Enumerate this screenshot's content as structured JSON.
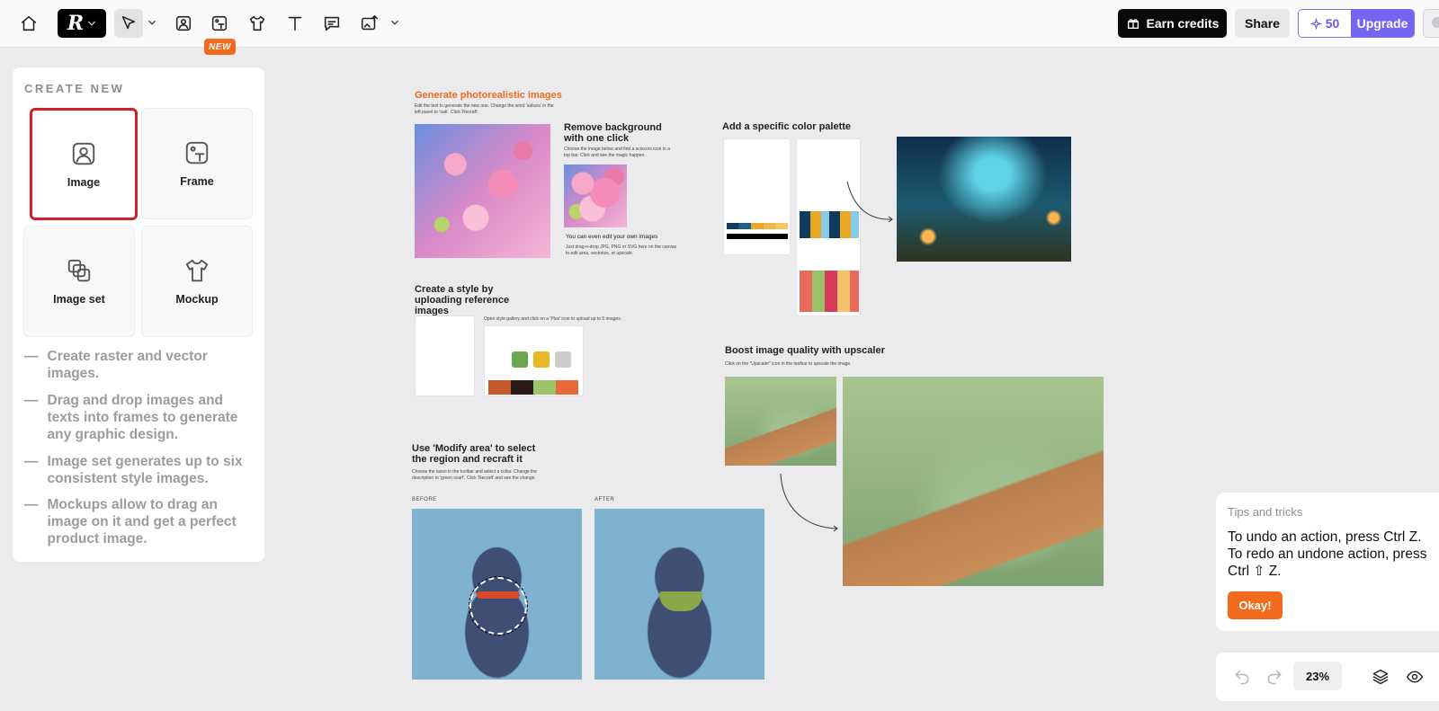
{
  "toolbar": {
    "new_badge": "NEW",
    "earn_credits": "Earn credits",
    "share": "Share",
    "credits": "50",
    "upgrade": "Upgrade"
  },
  "panel": {
    "title": "CREATE NEW",
    "tiles": [
      {
        "label": "Image"
      },
      {
        "label": "Frame"
      },
      {
        "label": "Image set"
      },
      {
        "label": "Mockup"
      }
    ],
    "descriptions": [
      "Create raster and vector images.",
      "Drag and drop images and texts into frames to generate any graphic design.",
      "Image set generates up to six consistent style images.",
      "Mockups allow to drag an image on it and get a perfect product image."
    ]
  },
  "canvas": {
    "gen_title": "Generate photorealistic images",
    "gen_desc": "Edit the text to generate the new one. Change the word 'sakura' in the left panel to 'oak'. Click 'Recraft'.",
    "remove_title": "Remove background with one click",
    "remove_desc": "Choose the image below and find a scissors icon in a top bar. Click and see the magic happen.",
    "edit_own": "You can even edit your own images",
    "edit_own_desc": "Just drag-n-drop JPG, PNG or SVG here on the canvas to edit area, vectorize, or upscale.",
    "palette_title": "Add a specific color palette",
    "style_title": "Create a style by uploading reference images",
    "style_desc": "Open style gallery and click on a 'Plus' icon to upload up to 5 images.",
    "upscale_title": "Boost image quality with upscaler",
    "upscale_desc": "Click on the \"Upscaler\" icon in the toolbar to upscale the image.",
    "modify_title": "Use 'Modify area' to select the region  and recraft it",
    "modify_desc": "Choose the lasso in the toolbar and select a collar. Change the description to 'green scarf'. Click 'Recraft' and see the change.",
    "before": "BEFORE",
    "after": "AFTER"
  },
  "tips": {
    "title": "Tips and tricks",
    "text": "To undo an action, press Ctrl Z.\nTo redo an undone action, press\nCtrl ⇧ Z.",
    "okay": "Okay!"
  },
  "bottom": {
    "zoom": "23%"
  }
}
